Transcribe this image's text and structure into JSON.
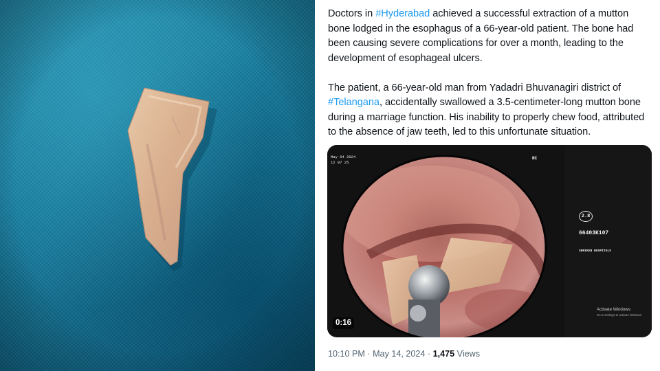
{
  "tweet": {
    "paragraph1": {
      "pre": "Doctors in ",
      "hashtag": "#Hyderabad",
      "post": " achieved a successful extraction of a mutton bone lodged in the esophagus of a 66-year-old patient. The bone had been causing severe complications for over a month, leading to the development of esophageal ulcers."
    },
    "paragraph2": {
      "pre": "The patient, a 66-year-old man from Yadadri Bhuvanagiri district of ",
      "hashtag": "#Telangana",
      "post": ", accidentally swallowed a 3.5-centimeter-long mutton bone during a marriage function. His inability to properly chew food, attributed to the absence of jaw teeth, led to this unfortunate situation."
    }
  },
  "video": {
    "duration": "0:16",
    "hud": {
      "date_line1": "May 04 2024",
      "date_line2": "12 07 25",
      "scope_label": "NC",
      "zoom": "2.8",
      "patient_id": "66403K107",
      "hospital": "SHRIKEN HOSPITALS"
    },
    "watermark_line1": "Activate Windows",
    "watermark_line2": "Go to Settings to activate Windows."
  },
  "meta": {
    "time": "10:10 PM",
    "separator1": " · ",
    "date": "May 14, 2024",
    "separator2": " · ",
    "views_count": "1,475",
    "views_label": " Views"
  },
  "colors": {
    "hashtag": "#1d9bf0",
    "text": "#0f1419",
    "meta": "#536471",
    "cloth": "#137a9c"
  }
}
